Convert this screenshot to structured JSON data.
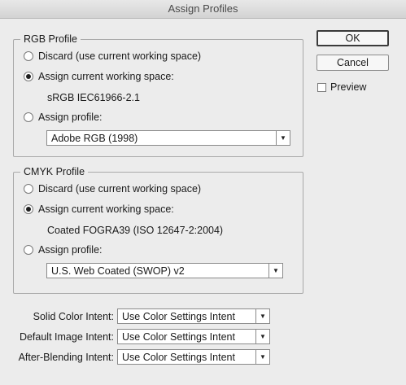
{
  "window": {
    "title": "Assign Profiles"
  },
  "buttons": {
    "ok": "OK",
    "cancel": "Cancel",
    "preview": "Preview"
  },
  "rgb": {
    "legend": "RGB Profile",
    "discard": "Discard (use current working space)",
    "assign_working": "Assign current working space:",
    "working_space": "sRGB IEC61966-2.1",
    "assign_profile": "Assign profile:",
    "profile_value": "Adobe RGB (1998)",
    "selected": "assign_working"
  },
  "cmyk": {
    "legend": "CMYK Profile",
    "discard": "Discard (use current working space)",
    "assign_working": "Assign current working space:",
    "working_space": "Coated FOGRA39 (ISO 12647-2:2004)",
    "assign_profile": "Assign profile:",
    "profile_value": "U.S. Web Coated (SWOP) v2",
    "selected": "assign_working"
  },
  "intents": [
    {
      "label": "Solid Color Intent:",
      "value": "Use Color Settings Intent"
    },
    {
      "label": "Default Image Intent:",
      "value": "Use Color Settings Intent"
    },
    {
      "label": "After-Blending Intent:",
      "value": "Use Color Settings Intent"
    }
  ],
  "icons": {
    "dropdown": "chevron-down-icon"
  }
}
